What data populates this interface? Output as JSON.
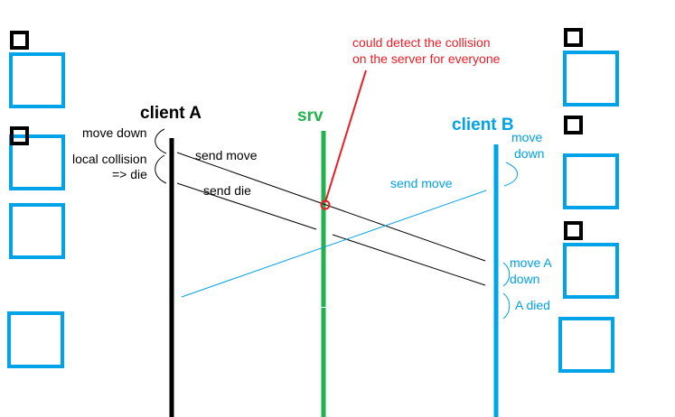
{
  "colors": {
    "black": "#000000",
    "green": "#22b14c",
    "blue": "#00a2e8",
    "red": "#ed1c24"
  },
  "titles": {
    "client_a": "client A",
    "srv": "srv",
    "client_b": "client B"
  },
  "client_a": {
    "move_down": "move down",
    "local_collision_1": "local collision",
    "local_collision_2": "=> die",
    "send_move": "send move",
    "send_die": "send die"
  },
  "srv": {
    "note_line_1": "could detect the collision",
    "note_line_2": "on the server for everyone"
  },
  "client_b": {
    "move_down_1": "move",
    "move_down_2": "down",
    "send_move": "send move",
    "move_a_down_1": "move A",
    "move_a_down_2": "down",
    "a_died": "A died"
  }
}
